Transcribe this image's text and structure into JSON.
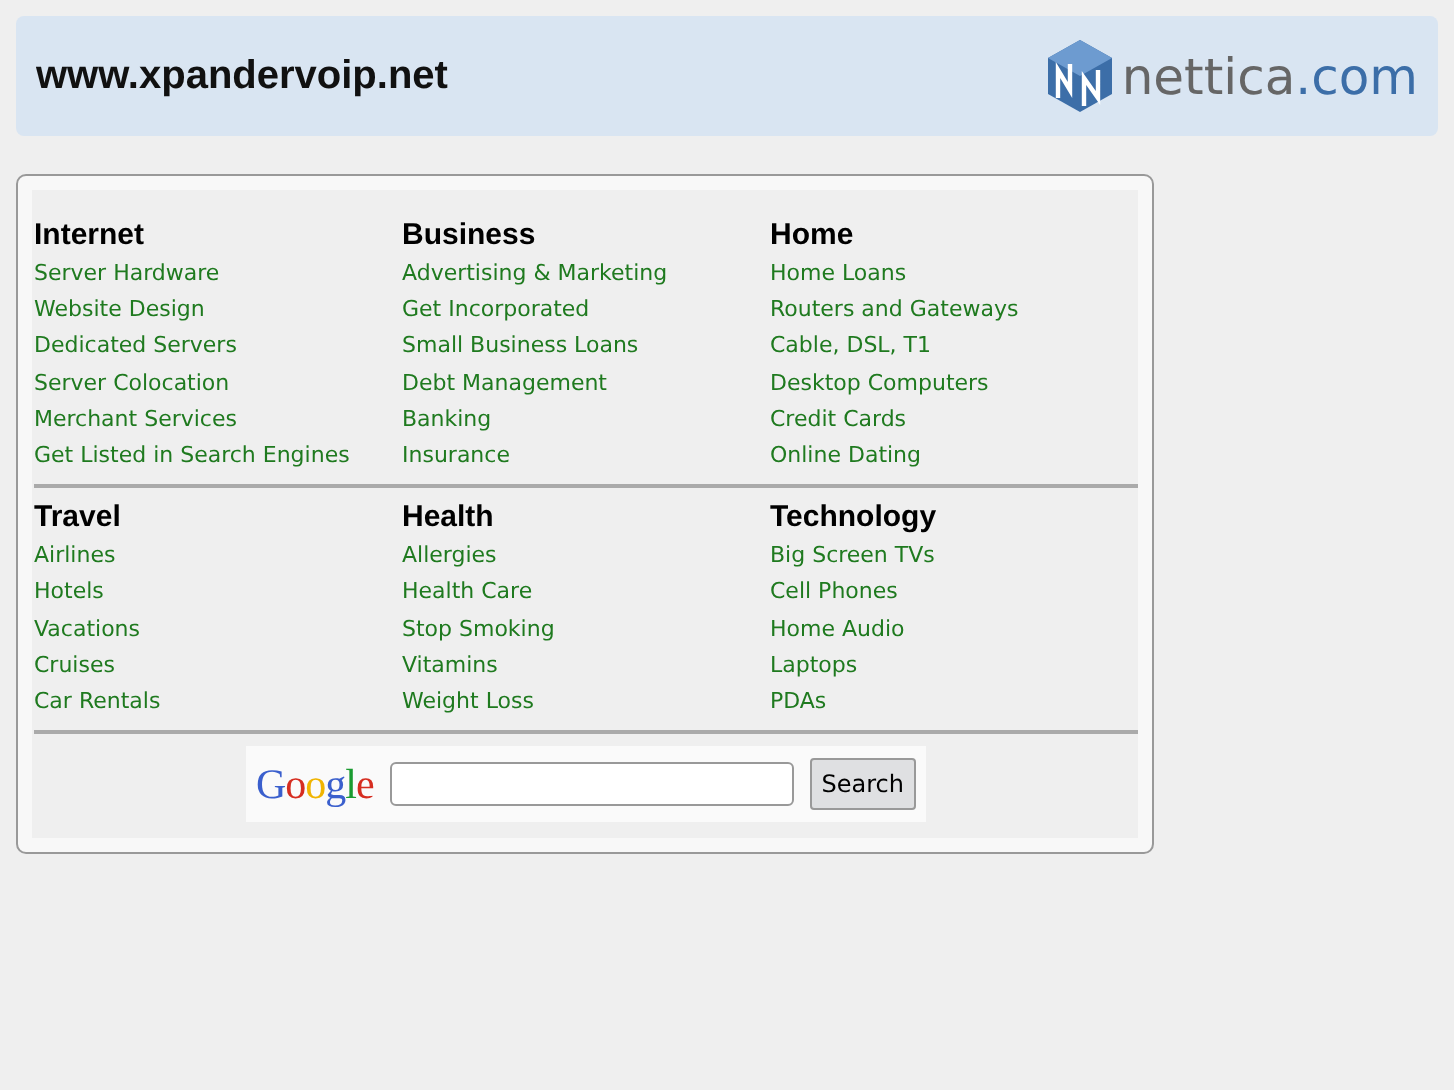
{
  "header": {
    "title": "www.xpandervoip.net",
    "logo": {
      "name": "nettica",
      "suffix": ".com"
    }
  },
  "sections": [
    {
      "categories": [
        {
          "title": "Internet",
          "links": [
            "Server Hardware",
            "Website Design",
            "Dedicated Servers",
            "Server Colocation",
            "Merchant Services",
            "Get Listed in Search Engines"
          ]
        },
        {
          "title": "Business",
          "links": [
            "Advertising & Marketing",
            "Get Incorporated",
            "Small Business Loans",
            "Debt Management",
            "Banking",
            "Insurance"
          ]
        },
        {
          "title": "Home",
          "links": [
            "Home Loans",
            "Routers and Gateways",
            "Cable, DSL, T1",
            "Desktop Computers",
            "Credit Cards",
            "Online Dating"
          ]
        }
      ]
    },
    {
      "categories": [
        {
          "title": "Travel",
          "links": [
            "Airlines",
            "Hotels",
            "Vacations",
            "Cruises",
            "Car Rentals"
          ]
        },
        {
          "title": "Health",
          "links": [
            "Allergies",
            "Health Care",
            "Stop Smoking",
            "Vitamins",
            "Weight Loss"
          ]
        },
        {
          "title": "Technology",
          "links": [
            "Big Screen TVs",
            "Cell Phones",
            "Home Audio",
            "Laptops",
            "PDAs"
          ]
        }
      ]
    }
  ],
  "search": {
    "logo": "Google",
    "button": "Search"
  }
}
